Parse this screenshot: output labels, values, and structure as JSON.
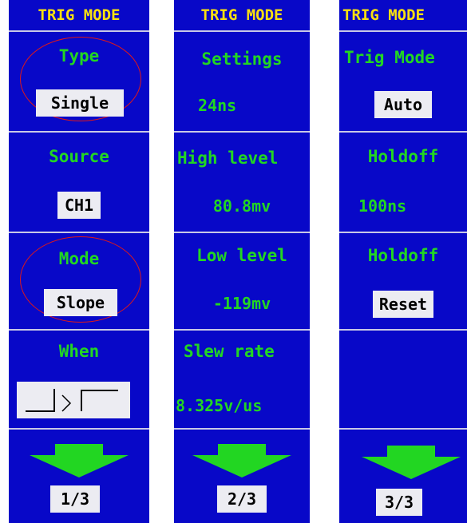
{
  "colors": {
    "panel_bg": "#0808c8",
    "title_text": "#f8e010",
    "label_text": "#22d622",
    "value_box_bg": "#ececf2",
    "highlight_ring": "#e01818",
    "arrow": "#22d622"
  },
  "panels": [
    {
      "title": "TRIG MODE",
      "items": [
        {
          "label": "Type",
          "value": "Single",
          "highlighted": true
        },
        {
          "label": "Source",
          "value": "CH1"
        },
        {
          "label": "Mode",
          "value": "Slope",
          "highlighted": true
        },
        {
          "label": "When",
          "value_icon": "rising-edge-slope-icon"
        }
      ],
      "page": "1/3",
      "next_icon": "down-arrow-icon"
    },
    {
      "title": "TRIG MODE",
      "items": [
        {
          "label": "Settings",
          "value": "24ns"
        },
        {
          "label": "High level",
          "value": "80.8mv"
        },
        {
          "label": "Low level",
          "value": "-119mv"
        },
        {
          "label": "Slew rate",
          "value": "8.325v/us"
        }
      ],
      "page": "2/3",
      "next_icon": "down-arrow-icon"
    },
    {
      "title": "TRIG MODE",
      "items": [
        {
          "label": "Trig Mode",
          "value": "Auto"
        },
        {
          "label": "Holdoff",
          "value": "100ns"
        },
        {
          "label": "Holdoff",
          "value": "Reset"
        },
        {
          "label": "",
          "value": ""
        }
      ],
      "page": "3/3",
      "next_icon": "down-arrow-icon"
    }
  ]
}
